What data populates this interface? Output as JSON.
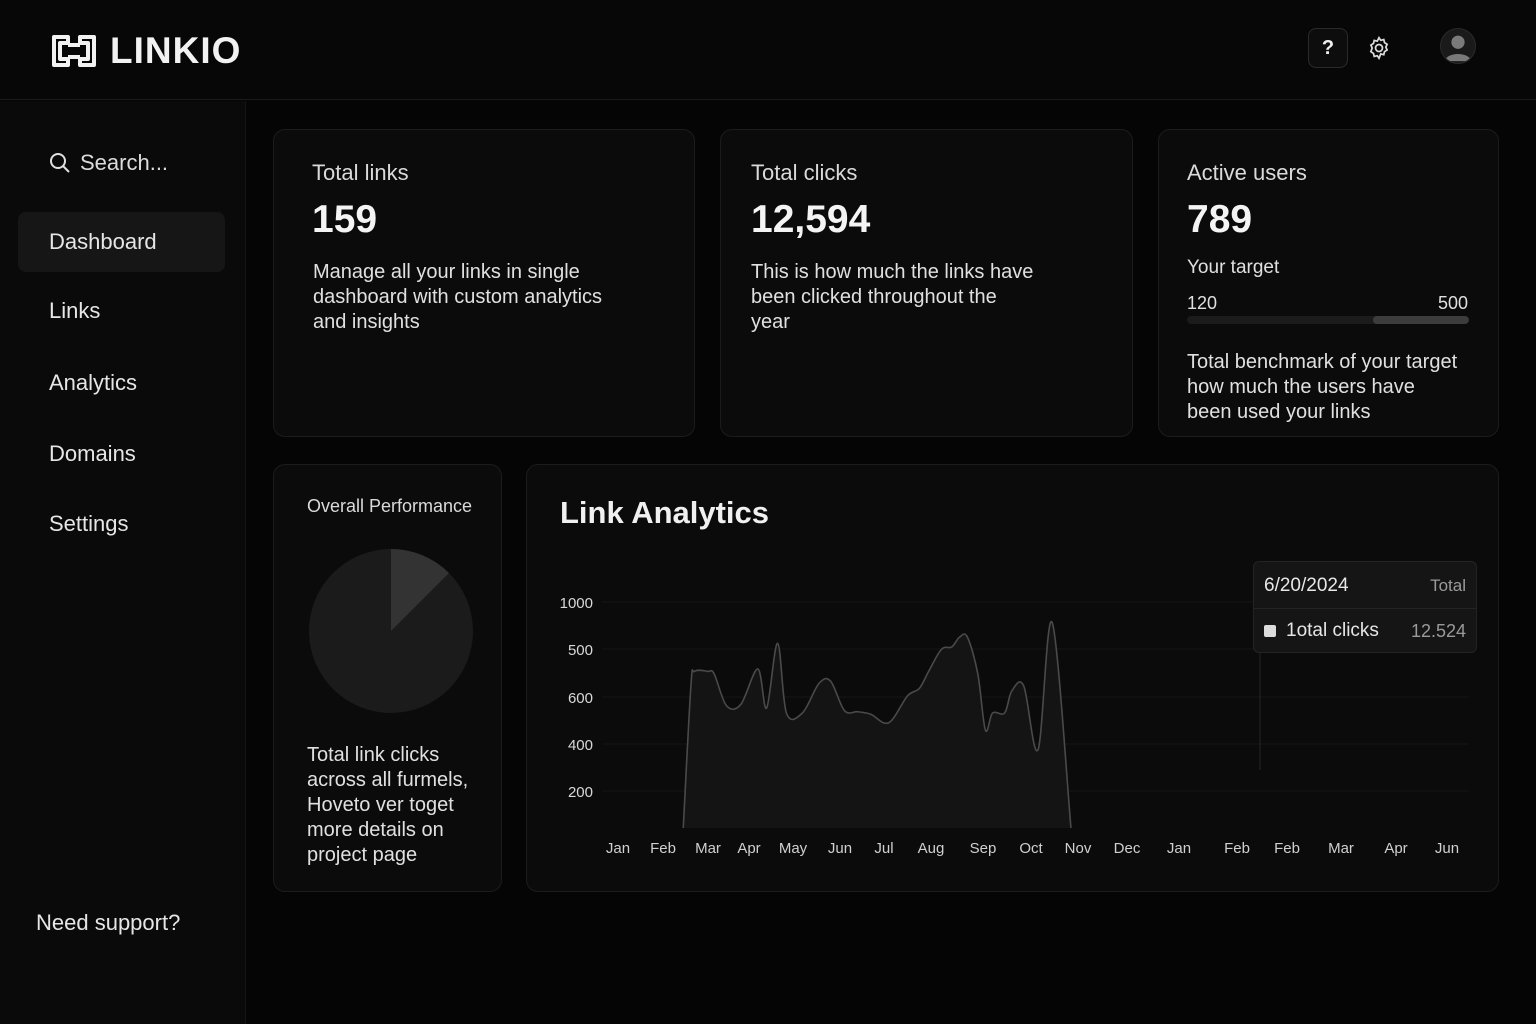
{
  "app": {
    "name": "LINKIO"
  },
  "header": {
    "help_label": "?"
  },
  "sidebar": {
    "search_placeholder": "Search...",
    "items": [
      {
        "label": "Dashboard",
        "active": true
      },
      {
        "label": "Links"
      },
      {
        "label": "Analytics"
      },
      {
        "label": "Domains"
      },
      {
        "label": "Settings"
      }
    ],
    "support": "Need support?"
  },
  "cards": {
    "total_links": {
      "title": "Total links",
      "value": "159",
      "desc": [
        "Manage all your links in single",
        "dashboard  with custom analytics",
        "and insights"
      ]
    },
    "total_clicks": {
      "title": "Total clicks",
      "value": "12,594",
      "desc": [
        "This is how much the links have",
        "been clicked throughout the",
        "year"
      ]
    },
    "active_users": {
      "title": "Active users",
      "value": "789",
      "target_label": "Your target",
      "target_min": "120",
      "target_max": "500",
      "progress_fraction": 0.34,
      "desc": [
        "Total benchmark of your target",
        "how much the users have",
        "been used your links"
      ]
    }
  },
  "performance": {
    "title": "Overall Performance",
    "pie_highlight_fraction": 0.125,
    "desc": [
      "Total link clicks",
      "across all furmels,",
      "Hoveto ver toget",
      "more details on",
      "project page"
    ]
  },
  "analytics": {
    "title": "Link Analytics"
  },
  "tooltip": {
    "date": "6/20/2024",
    "header_right": "Total",
    "series_label": "1otal clicks",
    "value": "12.524"
  },
  "colors": {
    "background": "#050505",
    "card": "#0b0b0b",
    "accent": "#f2f2f2",
    "muted": "#9a9a9a"
  },
  "chart_data": {
    "type": "area",
    "title": "Link Analytics",
    "xlabel": "",
    "ylabel": "",
    "y_ticks": [
      "1000",
      "500",
      "600",
      "400",
      "200"
    ],
    "categories": [
      "Jan",
      "Feb",
      "Mar",
      "Apr",
      "May",
      "Jun",
      "Jul",
      "Aug",
      "Sep",
      "Oct",
      "Nov",
      "Dec",
      "Jan",
      "Feb",
      "Feb",
      "Mar",
      "Apr",
      "Jun"
    ],
    "series": [
      {
        "name": "1otal clicks",
        "points": [
          [
            1.45,
            0
          ],
          [
            1.62,
            580
          ],
          [
            1.7,
            640
          ],
          [
            2.0,
            640
          ],
          [
            2.15,
            630
          ],
          [
            2.45,
            500
          ],
          [
            2.8,
            505
          ],
          [
            3.2,
            650
          ],
          [
            3.4,
            490
          ],
          [
            3.65,
            755
          ],
          [
            3.85,
            470
          ],
          [
            4.2,
            470
          ],
          [
            4.55,
            590
          ],
          [
            4.8,
            600
          ],
          [
            5.1,
            480
          ],
          [
            5.4,
            475
          ],
          [
            5.7,
            465
          ],
          [
            6.1,
            430
          ],
          [
            6.5,
            540
          ],
          [
            6.75,
            570
          ],
          [
            6.95,
            640
          ],
          [
            7.2,
            730
          ],
          [
            7.4,
            740
          ],
          [
            7.55,
            780
          ],
          [
            7.7,
            780
          ],
          [
            7.9,
            630
          ],
          [
            8.05,
            400
          ],
          [
            8.2,
            470
          ],
          [
            8.45,
            470
          ],
          [
            8.6,
            560
          ],
          [
            8.85,
            580
          ],
          [
            9.15,
            320
          ],
          [
            9.45,
            840
          ],
          [
            9.85,
            0
          ]
        ]
      }
    ],
    "grid": true,
    "legend": "tooltip top-right"
  }
}
